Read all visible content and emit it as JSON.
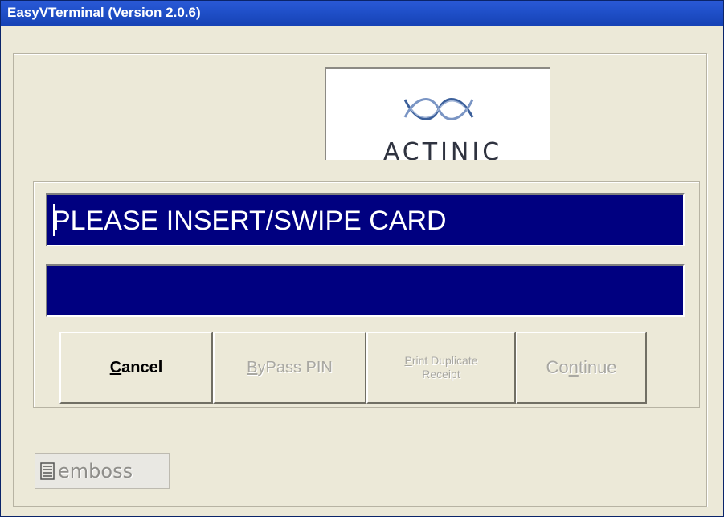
{
  "window": {
    "title": "EasyVTerminal (Version 2.0.6)"
  },
  "logo": {
    "text": "ACTINIC",
    "icon": "actinic-wave-logo"
  },
  "displays": {
    "line1": "PLEASE INSERT/SWIPE CARD",
    "line2": ""
  },
  "buttons": {
    "cancel": {
      "underline": "C",
      "rest": "ancel",
      "enabled": true
    },
    "bypass": {
      "underline": "B",
      "rest": "yPass PIN",
      "enabled": false
    },
    "print": {
      "underline": "P",
      "rest1": "rint Duplicate",
      "line2": "Receipt",
      "enabled": false
    },
    "continue": {
      "pre": "Co",
      "underline": "n",
      "rest": "tinue",
      "enabled": false
    }
  },
  "branding": {
    "emboss_text": "emboss",
    "icon": "emboss-stack-icon"
  },
  "colors": {
    "titlebar": "#1f4fc8",
    "display_bg": "#000080",
    "window_bg": "#ece9d8"
  }
}
